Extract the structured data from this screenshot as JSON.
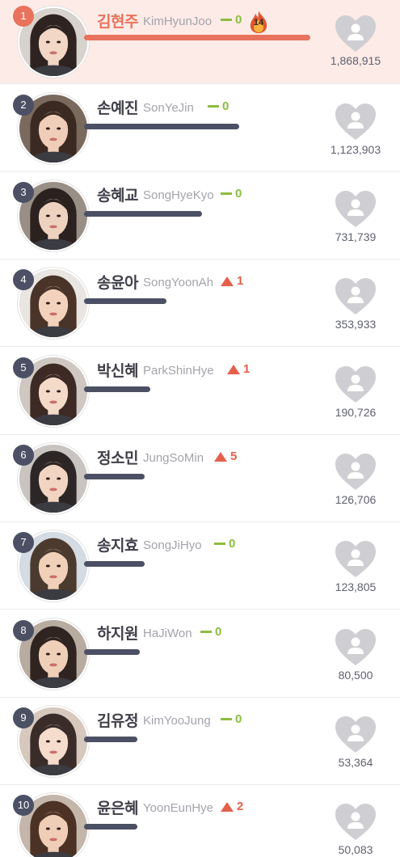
{
  "colors": {
    "highlight": "#fdebe7",
    "accent": "#e8725c",
    "rank_badge": "#4b5064",
    "no_change": "#8cbd3f",
    "rank_up": "#e5604b",
    "heart": "#cfcfd3"
  },
  "rows": [
    {
      "rank": "1",
      "name": "김현주",
      "roman": "KimHyunJoo",
      "change_type": "same",
      "change": "0",
      "streak": "14",
      "count": "1,868,915",
      "progress": 1.0
    },
    {
      "rank": "2",
      "name": "손예진",
      "roman": "SonYeJin",
      "change_type": "same",
      "change": "0",
      "count": "1,123,903",
      "progress": 0.601
    },
    {
      "rank": "3",
      "name": "송혜교",
      "roman": "SongHyeKyo",
      "change_type": "same",
      "change": "0",
      "count": "731,739",
      "progress": 0.391
    },
    {
      "rank": "4",
      "name": "송윤아",
      "roman": "SongYoonAh",
      "change_type": "up",
      "change": "1",
      "count": "353,933",
      "progress": 0.189
    },
    {
      "rank": "5",
      "name": "박신혜",
      "roman": "ParkShinHye",
      "change_type": "up",
      "change": "1",
      "count": "190,726",
      "progress": 0.102
    },
    {
      "rank": "6",
      "name": "정소민",
      "roman": "JungSoMin",
      "change_type": "up",
      "change": "5",
      "count": "126,706",
      "progress": 0.068
    },
    {
      "rank": "7",
      "name": "송지효",
      "roman": "SongJiHyo",
      "change_type": "same",
      "change": "0",
      "count": "123,805",
      "progress": 0.066
    },
    {
      "rank": "8",
      "name": "하지원",
      "roman": "HaJiWon",
      "change_type": "same",
      "change": "0",
      "count": "80,500",
      "progress": 0.043
    },
    {
      "rank": "9",
      "name": "김유정",
      "roman": "KimYooJung",
      "change_type": "same",
      "change": "0",
      "count": "53,364",
      "progress": 0.029
    },
    {
      "rank": "10",
      "name": "윤은혜",
      "roman": "YoonEunHye",
      "change_type": "up",
      "change": "2",
      "count": "50,083",
      "progress": 0.027
    }
  ],
  "icons": {
    "vote": "heart-icon",
    "streak": "fire-icon",
    "no_change": "dash-icon",
    "rank_up": "triangle-up-icon"
  }
}
